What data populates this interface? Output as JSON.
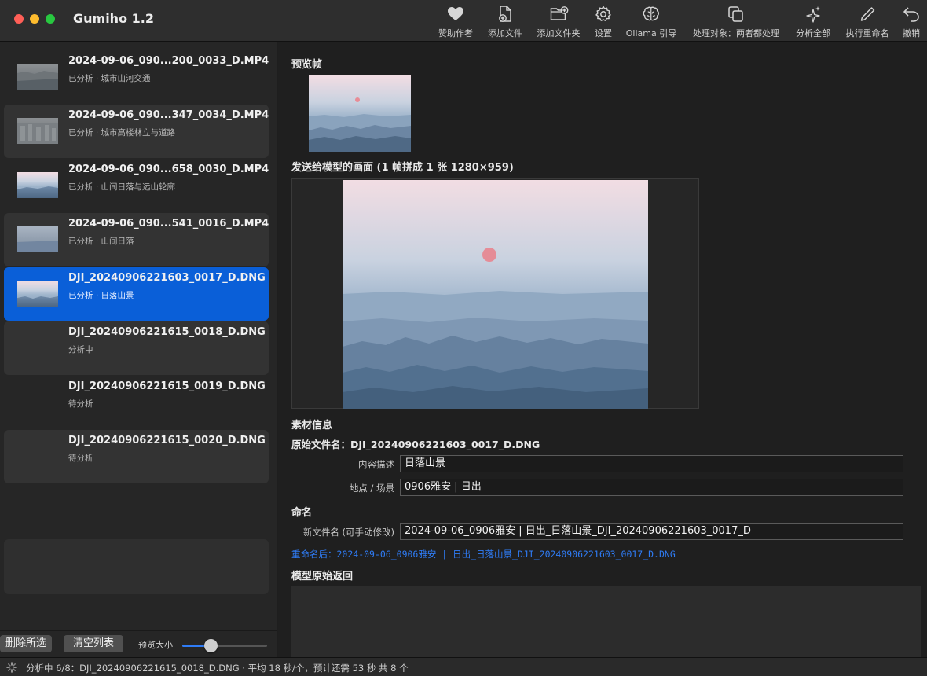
{
  "app": {
    "title": "Gumiho 1.2"
  },
  "toolbar": [
    {
      "name": "sponsor",
      "label": "赞助作者",
      "icon": "heart-icon"
    },
    {
      "name": "add-file",
      "label": "添加文件",
      "icon": "add-file-icon"
    },
    {
      "name": "add-folder",
      "label": "添加文件夹",
      "icon": "add-folder-icon"
    },
    {
      "name": "settings",
      "label": "设置",
      "icon": "gear-icon"
    },
    {
      "name": "ollama-guide",
      "label": "Ollama 引导",
      "icon": "brain-icon"
    },
    {
      "name": "process-target",
      "label": "处理对象：两者都处理",
      "icon": "copy-icon"
    },
    {
      "name": "analyze-all",
      "label": "分析全部",
      "icon": "sparkle-icon"
    },
    {
      "name": "execute-rename",
      "label": "执行重命名",
      "icon": "pen-icon"
    },
    {
      "name": "undo",
      "label": "撤销",
      "icon": "undo-icon"
    }
  ],
  "files": [
    {
      "name": "2024-09-06_090...200_0033_D.MP4",
      "status": "已分析 · 城市山河交通",
      "thumb": "city"
    },
    {
      "name": "2024-09-06_090...347_0034_D.MP4",
      "status": "已分析 · 城市高楼林立与道路",
      "thumb": "city"
    },
    {
      "name": "2024-09-06_090...658_0030_D.MP4",
      "status": "已分析 · 山间日落与远山轮廓",
      "thumb": "sunset"
    },
    {
      "name": "2024-09-06_090...541_0016_D.MP4",
      "status": "已分析 · 山间日落",
      "thumb": "haze"
    },
    {
      "name": "DJI_20240906221603_0017_D.DNG",
      "status": "已分析 · 日落山景",
      "thumb": "sunset",
      "selected": true
    },
    {
      "name": "DJI_20240906221615_0018_D.DNG",
      "status": "分析中",
      "thumb": ""
    },
    {
      "name": "DJI_20240906221615_0019_D.DNG",
      "status": "待分析",
      "thumb": ""
    },
    {
      "name": "DJI_20240906221615_0020_D.DNG",
      "status": "待分析",
      "thumb": ""
    }
  ],
  "sidebar_bottom": {
    "delete_selected": "删除所选",
    "clear_list": "清空列表",
    "preview_size_label": "预览大小",
    "preview_size_value": 0.33
  },
  "detail": {
    "preview_frame_title": "预览帧",
    "model_frame_title": "发送给模型的画面 (1 帧拼成 1 张 1280×959)",
    "material_title": "素材信息",
    "original_filename": "原始文件名：DJI_20240906221603_0017_D.DNG",
    "content_label": "内容描述",
    "content_value": "日落山景",
    "location_label": "地点 / 场景",
    "location_value": "0906雅安 | 日出",
    "naming_title": "命名",
    "new_name_label": "新文件名 (可手动修改)",
    "new_name_value": "2024-09-06_0906雅安 | 日出_日落山景_DJI_20240906221603_0017_D",
    "rename_after": "重命名后：2024-09-06_0906雅安 | 日出_日落山景_DJI_20240906221603_0017_D.DNG",
    "raw_title": "模型原始返回"
  },
  "status": {
    "text": "分析中 6/8：DJI_20240906221615_0018_D.DNG  ·  平均 18 秒/个，预计还需 53 秒   共 8 个"
  },
  "colors": {
    "accent": "#0a5fd8",
    "link": "#2f7cf6",
    "close": "#ff5f57",
    "minimize": "#febc2e",
    "zoom": "#28c840"
  }
}
